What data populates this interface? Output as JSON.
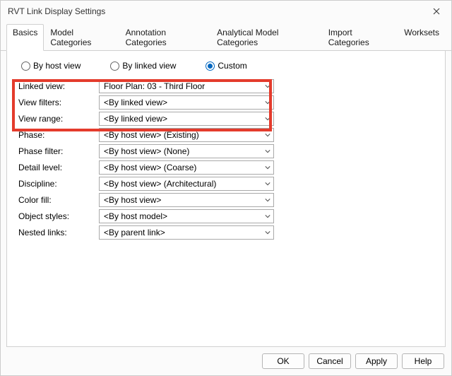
{
  "window": {
    "title": "RVT Link Display Settings"
  },
  "tabs": {
    "items": [
      {
        "label": "Basics"
      },
      {
        "label": "Model Categories"
      },
      {
        "label": "Annotation Categories"
      },
      {
        "label": "Analytical Model Categories"
      },
      {
        "label": "Import Categories"
      },
      {
        "label": "Worksets"
      }
    ],
    "active_index": 0
  },
  "radios": {
    "host": "By host view",
    "linked": "By linked view",
    "custom": "Custom",
    "selected": "custom"
  },
  "fields": {
    "linked_view": {
      "label": "Linked view:",
      "value": "Floor Plan: 03 - Third Floor"
    },
    "view_filters": {
      "label": "View filters:",
      "value": "<By linked view>"
    },
    "view_range": {
      "label": "View range:",
      "value": "<By linked view>"
    },
    "phase": {
      "label": "Phase:",
      "value": "<By host view> (Existing)"
    },
    "phase_filter": {
      "label": "Phase filter:",
      "value": "<By host view> (None)"
    },
    "detail_level": {
      "label": "Detail level:",
      "value": "<By host view> (Coarse)"
    },
    "discipline": {
      "label": "Discipline:",
      "value": "<By host view> (Architectural)"
    },
    "color_fill": {
      "label": "Color fill:",
      "value": "<By host view>"
    },
    "object_styles": {
      "label": "Object styles:",
      "value": "<By host model>"
    },
    "nested_links": {
      "label": "Nested links:",
      "value": "<By parent link>"
    }
  },
  "buttons": {
    "ok": "OK",
    "cancel": "Cancel",
    "apply": "Apply",
    "help": "Help"
  },
  "colors": {
    "highlight": "#e43b2c",
    "accent": "#0067c0"
  }
}
